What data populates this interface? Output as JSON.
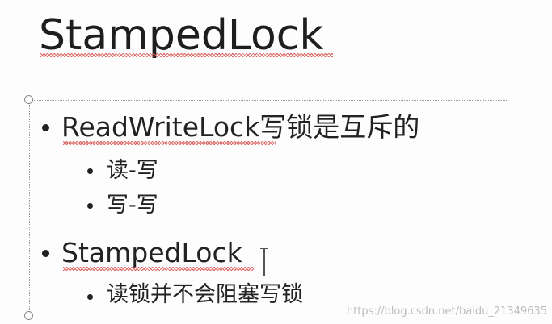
{
  "slide": {
    "title": "StampedLock",
    "bullets": [
      {
        "level": 1,
        "text_en": "ReadWriteLock",
        "text_cn": "写锁是互斥的",
        "children": [
          {
            "level": 2,
            "text": "读-写"
          },
          {
            "level": 2,
            "text": "写-写"
          }
        ]
      },
      {
        "level": 1,
        "text_en": "StampedLock",
        "text_cn": "",
        "children": [
          {
            "level": 2,
            "text": "读锁并不会阻塞写锁"
          }
        ]
      }
    ]
  },
  "watermark": "https://blog.csdn.net/baidu_21349635",
  "colors": {
    "text": "#222222",
    "spellcheck": "#d9534f",
    "placeholder_border": "#9a9a9a"
  },
  "icons": {
    "resize_handle": "circle-handle-icon",
    "text_cursor": "i-beam-cursor-icon"
  }
}
